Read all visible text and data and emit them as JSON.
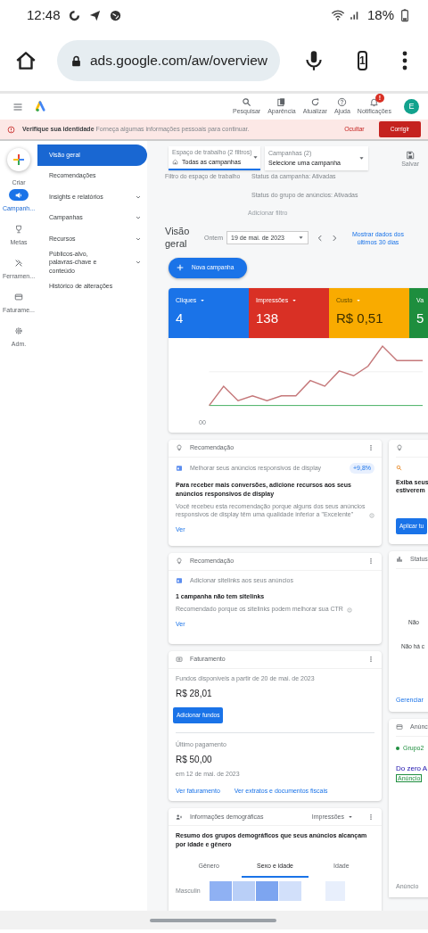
{
  "status_bar": {
    "time": "12:48",
    "battery": "18%"
  },
  "browser": {
    "url": "ads.google.com/aw/overview",
    "tab_count": "1"
  },
  "header": {
    "tools": [
      {
        "label": "Pesquisar",
        "kind": "search"
      },
      {
        "label": "Aparência",
        "kind": "appearance"
      },
      {
        "label": "Atualizar",
        "kind": "refresh"
      },
      {
        "label": "Ajuda",
        "kind": "help"
      },
      {
        "label": "Notificações",
        "kind": "bell",
        "badge": "!"
      }
    ],
    "avatar": "E"
  },
  "alert": {
    "title": "Verifique sua identidade",
    "message": "Forneça algumas informações pessoais para continuar.",
    "dismiss": "Ocultar",
    "action": "Corrigir"
  },
  "rail": [
    {
      "label": "Criar",
      "kind": "create",
      "selected": false
    },
    {
      "label": "Campanh...",
      "kind": "campaign",
      "selected": true
    },
    {
      "label": "Metas",
      "kind": "goals",
      "selected": false
    },
    {
      "label": "Ferramen...",
      "kind": "tools",
      "selected": false
    },
    {
      "label": "Faturame...",
      "kind": "billing",
      "selected": false
    },
    {
      "label": "Adm.",
      "kind": "admin",
      "selected": false
    }
  ],
  "nav": [
    {
      "label": "Visão geral",
      "selected": true,
      "expandable": false
    },
    {
      "label": "Recomendações",
      "selected": false,
      "expandable": false
    },
    {
      "label": "Insights e relatórios",
      "selected": false,
      "expandable": true
    },
    {
      "label": "Campanhas",
      "selected": false,
      "expandable": true
    },
    {
      "label": "Recursos",
      "selected": false,
      "expandable": true
    },
    {
      "label": "Públicos-alvo, palavras-chave e conteúdo",
      "selected": false,
      "expandable": true
    },
    {
      "label": "Histórico de alterações",
      "selected": false,
      "expandable": false
    }
  ],
  "filters": {
    "workspace": {
      "label": "Espaço de trabalho (2 filtros)",
      "value": "Todas as campanhas"
    },
    "campaigns": {
      "label": "Campanhas (2)",
      "value": "Selecione uma campanha"
    },
    "filter_label": "Filtro do espaço de trabalho",
    "statuses": [
      "Status da campanha: Ativadas",
      "Status do grupo de anúncios: Ativadas"
    ],
    "add_filter": "Adicionar filtro",
    "save": "Salvar"
  },
  "overview": {
    "title": "Visão geral",
    "date_label": "Ontem",
    "date": "19 de mai. de 2023",
    "range_link": "Mostrar dados dos últimos 30 dias",
    "new_campaign": "Nova campanha"
  },
  "metrics": [
    {
      "label": "Cliques",
      "value": "4",
      "color": "#1a73e8"
    },
    {
      "label": "Impressões",
      "value": "138",
      "color": "#d93025"
    },
    {
      "label": "Custo",
      "value": "R$ 0,51",
      "color": "#f9ab00"
    },
    {
      "label": "Va",
      "value": "5",
      "color": "#1e8e3e"
    }
  ],
  "chart": {
    "x_label": "00"
  },
  "recommendations": [
    {
      "header": "Recomendação",
      "item": "Melhorar seus anúncios responsivos de display",
      "badge": "+9,8%",
      "title": "Para receber mais conversões, adicione recursos aos seus anúncios responsivos de display",
      "description": "Você recebeu esta recomendação porque alguns dos seus anúncios responsivos de display têm uma qualidade inferior a \"Excelente\"",
      "link": "Ver"
    },
    {
      "header": "Recomendação",
      "item": "Adicionar sitelinks aos seus anúncios",
      "title": "1 campanha não tem sitelinks",
      "description": "Recomendado porque os sitelinks podem melhorar sua CTR",
      "link": "Ver"
    }
  ],
  "billing": {
    "header": "Faturamento",
    "funds_label": "Fundos disponíveis a partir de 20 de mai. de 2023",
    "funds": "R$ 28,01",
    "add_funds": "Adicionar fundos",
    "last_payment_label": "Último pagamento",
    "last_payment": "R$ 50,00",
    "last_payment_date": "em 12 de mai. de 2023",
    "links": [
      "Ver faturamento",
      "Ver extratos e documentos fiscais"
    ]
  },
  "demographics": {
    "header": "Informações demográficas",
    "metric": "Impressões",
    "summary": "Resumo dos grupos demográficos que seus anúncios alcançam por idade e gênero",
    "tabs": [
      {
        "label": "Gênero",
        "selected": false
      },
      {
        "label": "Sexo e idade",
        "selected": true
      },
      {
        "label": "Idade",
        "selected": false
      }
    ],
    "row_label": "Masculin"
  },
  "side_cards": [
    {
      "lines": [
        "Exiba seus",
        "estiverem"
      ],
      "button": "Aplicar tu"
    },
    {
      "header": "Status",
      "lines": [
        "Não",
        "Não há c"
      ],
      "link": "Gerenciar"
    },
    {
      "header": "Anúnc",
      "group": "Grupo2",
      "title": "Do zero A",
      "tag": "Anúncio",
      "footer": "Anúncio"
    }
  ]
}
